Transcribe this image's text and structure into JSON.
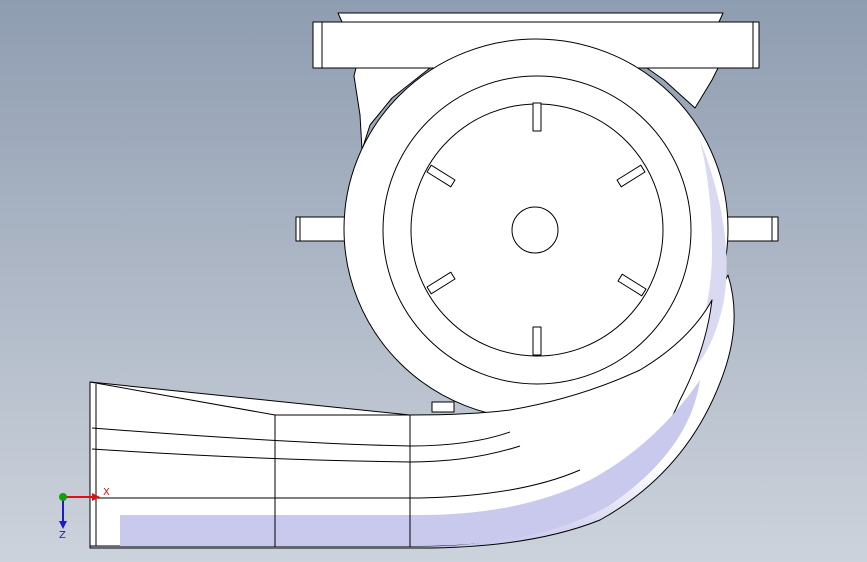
{
  "view": {
    "background_top": "#8f9db1",
    "background_bottom": "#cdd3dc",
    "part_fill": "#ffffff",
    "edge_color": "#000000",
    "shade_color": "#b9b9e6"
  },
  "triad": {
    "x_label": "X",
    "z_label": "Z",
    "x_color": "#e01010",
    "y_color": "#10a010",
    "z_color": "#1a1ad0"
  }
}
